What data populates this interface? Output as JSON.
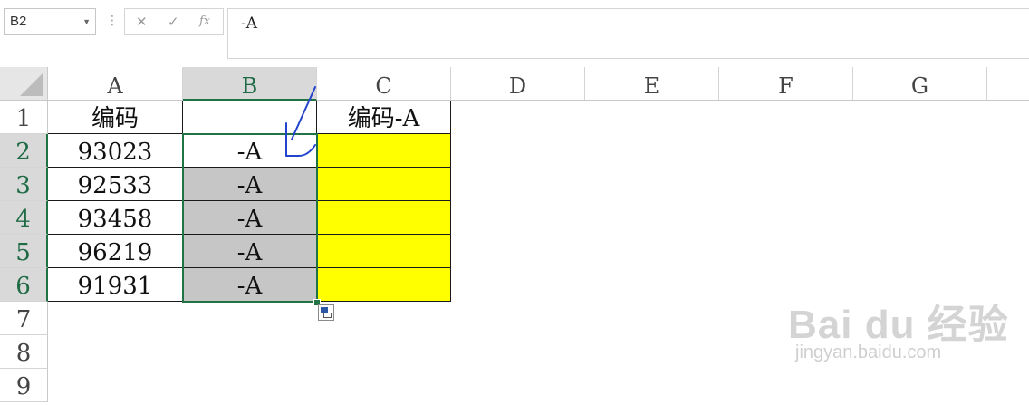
{
  "formula_bar": {
    "name_box": "B2",
    "cancel_icon": "✕",
    "enter_icon": "✓",
    "fx_label": "fx",
    "formula": "-A"
  },
  "columns": [
    "A",
    "B",
    "C",
    "D",
    "E",
    "F",
    "G"
  ],
  "rows": [
    "1",
    "2",
    "3",
    "4",
    "5",
    "6",
    "7",
    "8",
    "9"
  ],
  "cells": {
    "A1": "编码",
    "B1": "",
    "C1": "编码-A",
    "A2": "93023",
    "B2": "-A",
    "C2": "",
    "A3": "92533",
    "B3": "-A",
    "C3": "",
    "A4": "93458",
    "B4": "-A",
    "C4": "",
    "A5": "96219",
    "B5": "-A",
    "C5": "",
    "A6": "91931",
    "B6": "-A",
    "C6": ""
  },
  "active_cell": "B2",
  "selected_range": "B2:B6",
  "colors": {
    "highlight": "#ffff00",
    "selection": "#217346",
    "fill_gray": "#c6c6c6",
    "annotation": "#2244cc"
  },
  "watermark": {
    "brand": "Bai du 经验",
    "url": "jingyan.baidu.com"
  }
}
